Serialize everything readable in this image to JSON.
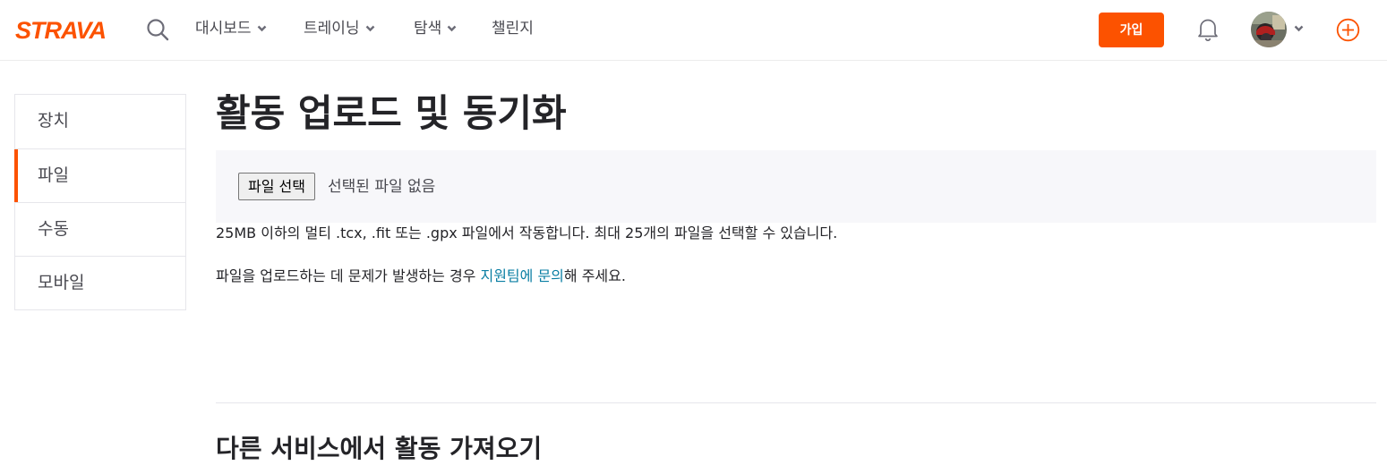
{
  "header": {
    "logo_text": "STRAVA",
    "brand_color": "#fc5200",
    "search_icon": "search-icon",
    "nav": [
      {
        "label": "대시보드",
        "has_dropdown": true
      },
      {
        "label": "트레이닝",
        "has_dropdown": true
      },
      {
        "label": "탐색",
        "has_dropdown": true
      },
      {
        "label": "챌린지",
        "has_dropdown": false
      }
    ],
    "join_label": "가입",
    "notifications_icon": "bell-icon",
    "avatar_icon": "avatar",
    "add_icon": "plus-circle-icon"
  },
  "sidebar": {
    "items": [
      {
        "label": "장치",
        "active": false
      },
      {
        "label": "파일",
        "active": true
      },
      {
        "label": "수동",
        "active": false
      },
      {
        "label": "모바일",
        "active": false
      }
    ]
  },
  "main": {
    "title": "활동 업로드 및 동기화",
    "file_button_label": "파일 선택",
    "file_status": "선택된 파일 없음",
    "info_line": "25MB 이하의 멀티 .tcx, .fit 또는 .gpx 파일에서 작동합니다. 최대 25개의 파일을 선택할 수 있습니다.",
    "help_prefix": "파일을 업로드하는 데 문제가 발생하는 경우 ",
    "help_link": "지원팀에 문의",
    "help_suffix": "해 주세요.",
    "section_title": "다른 서비스에서 활동 가져오기",
    "link_color": "#0a7ea3"
  }
}
